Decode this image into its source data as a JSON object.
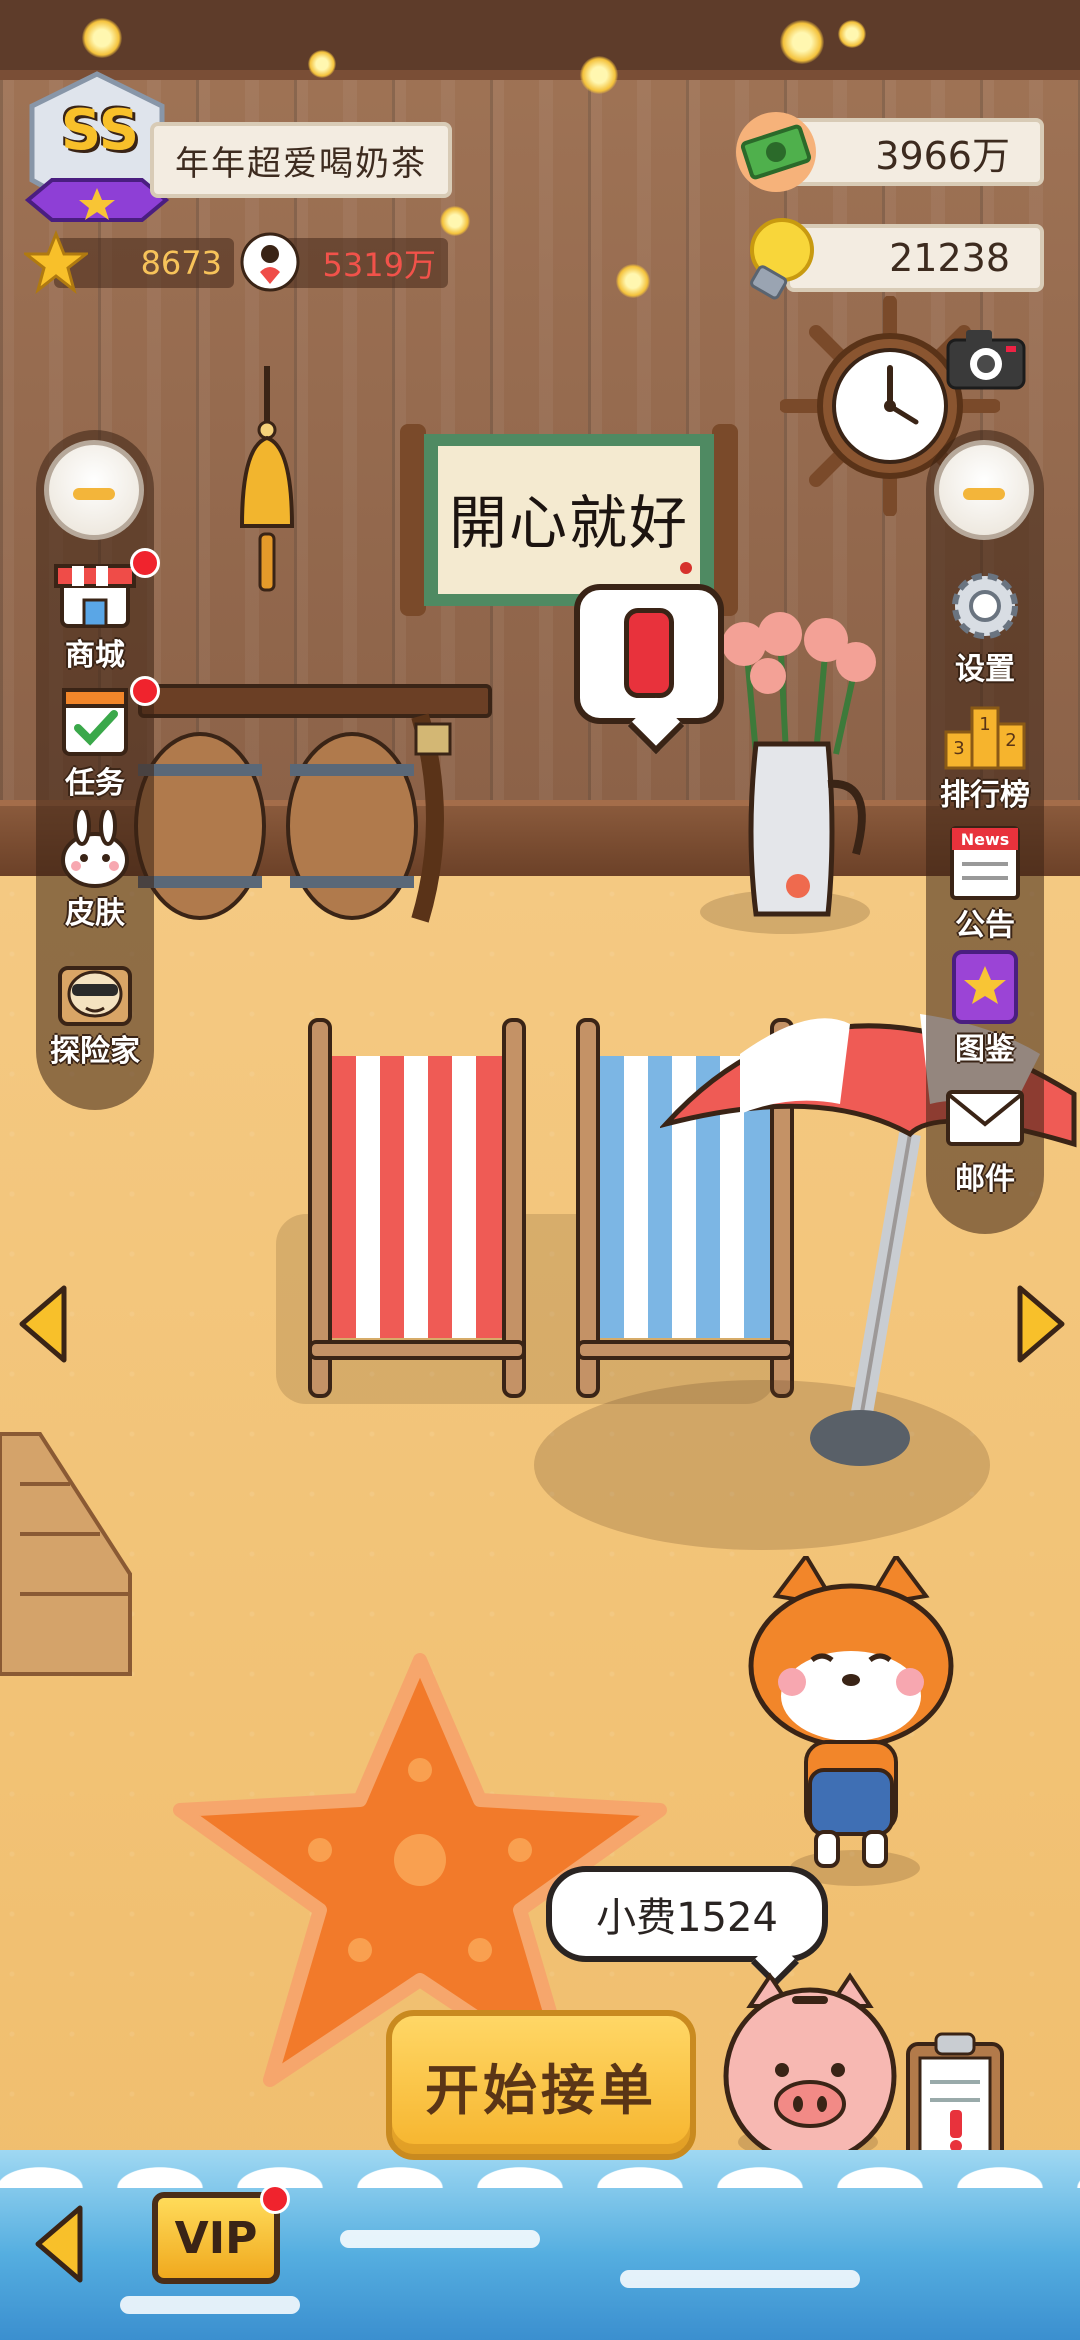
{
  "player": {
    "rank": "SS",
    "name": "年年超爱喝奶茶",
    "stars": "8673",
    "likes": "5319万"
  },
  "resources": {
    "money": "3966万",
    "ideas": "21238"
  },
  "scene": {
    "scroll_text": "開心就好"
  },
  "left_menu": [
    {
      "label": "商城",
      "icon": "shop-icon",
      "badge": true
    },
    {
      "label": "任务",
      "icon": "task-icon",
      "badge": true
    },
    {
      "label": "皮肤",
      "icon": "skin-icon",
      "badge": false
    },
    {
      "label": "探险家",
      "icon": "explorer-icon",
      "badge": false
    }
  ],
  "right_menu": [
    {
      "label": "设置",
      "icon": "gear-icon"
    },
    {
      "label": "排行榜",
      "icon": "podium-icon",
      "podium": [
        "1",
        "2",
        "3"
      ]
    },
    {
      "label": "公告",
      "icon": "news-icon",
      "icon_text": "News"
    },
    {
      "label": "图鉴",
      "icon": "album-icon"
    },
    {
      "label": "邮件",
      "icon": "mail-icon"
    }
  ],
  "tip": "小费1524",
  "start_button": "开始接单",
  "vip_button": "VIP",
  "colors": {
    "wall": "#8c6248",
    "sand": "#f0bd6c",
    "accent": "#f6b42d",
    "badge": "#f0232d",
    "ocean": "#55aee0"
  }
}
